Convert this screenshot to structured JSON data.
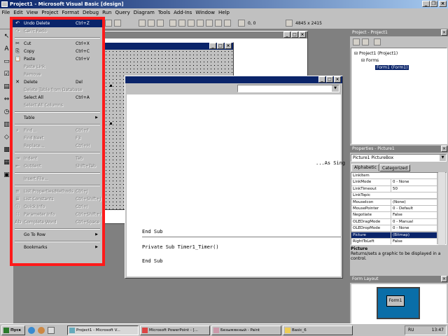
{
  "window": {
    "title": "Project1 - Microsoft Visual Basic [design]"
  },
  "menubar": [
    "File",
    "Edit",
    "View",
    "Project",
    "Format",
    "Debug",
    "Run",
    "Query",
    "Diagram",
    "Tools",
    "Add-Ins",
    "Window",
    "Help"
  ],
  "toolbar": {
    "position": "0, 0",
    "size": "4845 x 2415"
  },
  "edit_menu": {
    "items": [
      {
        "label": "Undo Delete",
        "shortcut": "Ctrl+Z",
        "disabled": false,
        "highlight": true,
        "icon": "undo-icon"
      },
      {
        "label": "Can't Redo",
        "shortcut": "",
        "disabled": true,
        "icon": "redo-icon"
      },
      {
        "sep": true
      },
      {
        "label": "Cut",
        "shortcut": "Ctrl+X",
        "disabled": false,
        "icon": "cut-icon"
      },
      {
        "label": "Copy",
        "shortcut": "Ctrl+C",
        "disabled": false,
        "icon": "copy-icon"
      },
      {
        "label": "Paste",
        "shortcut": "Ctrl+V",
        "disabled": false,
        "icon": "paste-icon"
      },
      {
        "label": "Paste Link",
        "shortcut": "",
        "disabled": true
      },
      {
        "label": "Remove",
        "shortcut": "",
        "disabled": true
      },
      {
        "label": "Delete",
        "shortcut": "Del",
        "disabled": false,
        "icon": "delete-icon"
      },
      {
        "label": "Delete Table from Database",
        "shortcut": "",
        "disabled": true
      },
      {
        "label": "Select All",
        "shortcut": "Ctrl+A",
        "disabled": false
      },
      {
        "label": "Select All Columns",
        "shortcut": "",
        "disabled": true
      },
      {
        "sep": true
      },
      {
        "label": "Table",
        "shortcut": "",
        "disabled": false,
        "submenu": true
      },
      {
        "sep": true
      },
      {
        "label": "Find...",
        "shortcut": "Ctrl+F",
        "disabled": true,
        "icon": "find-icon"
      },
      {
        "label": "Find Next",
        "shortcut": "F3",
        "disabled": true
      },
      {
        "label": "Replace...",
        "shortcut": "Ctrl+H",
        "disabled": true
      },
      {
        "sep": true
      },
      {
        "label": "Indent",
        "shortcut": "Tab",
        "disabled": true,
        "icon": "indent-icon"
      },
      {
        "label": "Outdent",
        "shortcut": "Shift+Tab",
        "disabled": true,
        "icon": "outdent-icon"
      },
      {
        "sep": true
      },
      {
        "label": "Insert File...",
        "shortcut": "",
        "disabled": true
      },
      {
        "sep": true
      },
      {
        "label": "List Properties/Methods",
        "shortcut": "Ctrl+J",
        "disabled": true,
        "icon": "list-icon"
      },
      {
        "label": "List Constants",
        "shortcut": "Ctrl+Shift+J",
        "disabled": true,
        "icon": "constants-icon"
      },
      {
        "label": "Quick Info",
        "shortcut": "Ctrl+I",
        "disabled": true,
        "icon": "info-icon"
      },
      {
        "label": "Parameter Info",
        "shortcut": "Ctrl+Shift+I",
        "disabled": true,
        "icon": "param-icon"
      },
      {
        "label": "Complete Word",
        "shortcut": "Ctrl+Space",
        "disabled": true,
        "icon": "word-icon"
      },
      {
        "sep": true
      },
      {
        "label": "Go To Row",
        "shortcut": "",
        "disabled": false,
        "submenu": true
      },
      {
        "sep": true
      },
      {
        "label": "Bookmarks",
        "shortcut": "",
        "disabled": false,
        "submenu": true
      }
    ]
  },
  "form_window": {
    "title": ""
  },
  "code_window": {
    "partial_line": "...As Sing",
    "lines": [
      "End Sub",
      "Private Sub Timer1_Timer()",
      "End Sub"
    ]
  },
  "project_explorer": {
    "title": "Project - Project1",
    "root": "Project1 (Project1)",
    "folder": "Forms",
    "form": "Form1 (Form1)"
  },
  "properties": {
    "title": "Properties - Picture1",
    "object": "Picture1 PictureBox",
    "tabs": [
      "Alphabetic",
      "Categorized"
    ],
    "rows": [
      {
        "k": "LinkItem",
        "v": ""
      },
      {
        "k": "LinkMode",
        "v": "0 - None"
      },
      {
        "k": "LinkTimeout",
        "v": "50"
      },
      {
        "k": "LinkTopic",
        "v": ""
      },
      {
        "k": "MouseIcon",
        "v": "(None)"
      },
      {
        "k": "MousePointer",
        "v": "0 - Default"
      },
      {
        "k": "Negotiate",
        "v": "False"
      },
      {
        "k": "OLEDragMode",
        "v": "0 - Manual"
      },
      {
        "k": "OLEDropMode",
        "v": "0 - None"
      },
      {
        "k": "Picture",
        "v": "(Bitmap)",
        "sel": true
      },
      {
        "k": "RightToLeft",
        "v": "False"
      }
    ],
    "desc_title": "Picture",
    "desc_text": "Returns/sets a graphic to be displayed in a control."
  },
  "form_layout": {
    "title": "Form Layout",
    "form": "Form1"
  },
  "taskbar": {
    "start": "Пуск",
    "tasks": [
      "Project1 - Microsoft V...",
      "Microsoft PowerPoint - [...",
      "Безымянный - Paint",
      "Basic_6"
    ],
    "tray": "13:47",
    "lang": "RU"
  }
}
